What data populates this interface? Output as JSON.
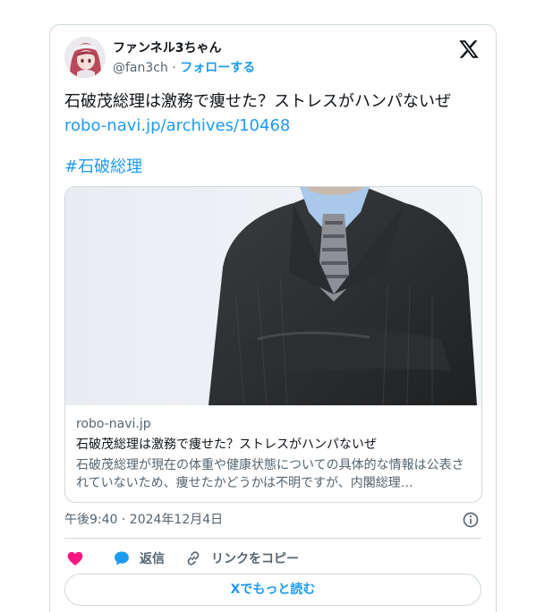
{
  "author": {
    "display_name": "ファンネル3ちゃん",
    "handle": "@fan3ch",
    "separator": " · ",
    "follow_label": "フォローする"
  },
  "tweet": {
    "text": "石破茂総理は激務で痩せた？ストレスがハンパないぜ ",
    "link_text": "robo-navi.jp/archives/10468",
    "hashtag": "#石破総理"
  },
  "link_card": {
    "domain": "robo-navi.jp",
    "title": "石破茂総理は激務で痩せた？ストレスがハンパないぜ",
    "description": "石破茂総理が現在の体重や健康状態についての具体的な情報は公表されていないため、痩せたかどうかは不明ですが、内閣総理…"
  },
  "timestamp": "午後9:40 · 2024年12月4日",
  "actions": {
    "like_label": "",
    "reply_label": "返信",
    "copy_link_label": "リンクをコピー"
  },
  "read_more_label": "Xでもっと読む",
  "icons": {
    "platform": "x-logo-icon",
    "info": "info-icon",
    "like": "heart-icon",
    "reply": "speech-bubble-icon",
    "copy": "link-icon"
  },
  "colors": {
    "accent": "#1d9bf0",
    "like": "#f91880",
    "text": "#0f1419",
    "secondary": "#536471",
    "border": "#cfd9de"
  }
}
